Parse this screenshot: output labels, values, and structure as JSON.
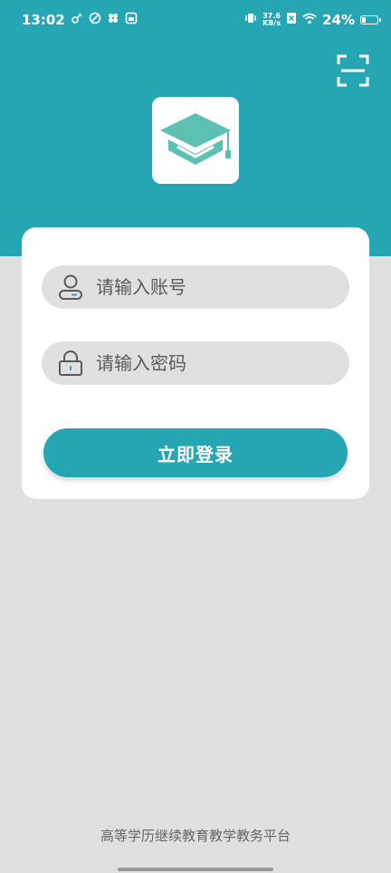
{
  "status_bar": {
    "time": "13:02",
    "net_speed_value": "37.6",
    "net_speed_unit": "KB/s",
    "battery_percent": "24%",
    "battery_level": 0.24
  },
  "header": {
    "color": "#26a6b2",
    "scan_icon": "scan-icon",
    "logo_icon": "graduation-cap-icon"
  },
  "login": {
    "account_placeholder": "请输入账号",
    "password_placeholder": "请输入密码",
    "submit_label": "立即登录"
  },
  "footer": {
    "platform_name": "高等学历继续教育教学教务平台"
  }
}
